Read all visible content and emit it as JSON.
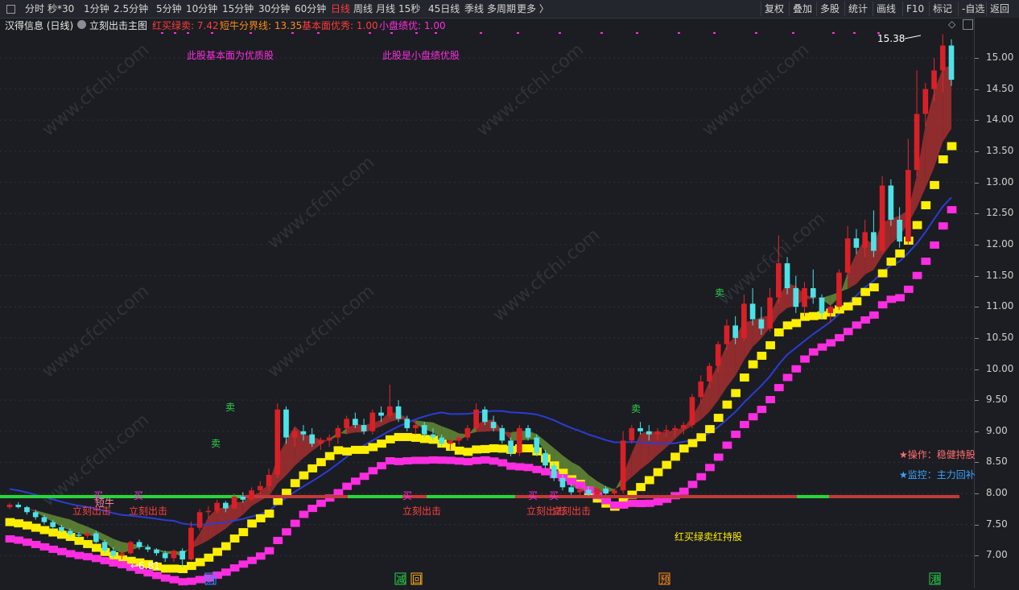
{
  "toolbar": {
    "left_items": [
      "分时",
      "秒*30",
      "1分钟",
      "2.5分钟",
      "5分钟",
      "10分钟",
      "15分钟",
      "30分钟",
      "60分钟",
      "日线",
      "周线",
      "月线",
      "15秒",
      "45日线",
      "季线",
      "多周期",
      "更多 〉"
    ],
    "active_item": "日线",
    "right_items": [
      "复权",
      "叠加",
      "多股",
      "统计",
      "画线",
      "F10",
      "标记",
      "-自选",
      "返回"
    ]
  },
  "info": {
    "stock_name": "汉得信息 (日线)",
    "indicator_name": "立刻出击主图",
    "params": [
      {
        "label": "红买绿卖:",
        "value": "7.42",
        "color": "#ff3b3b"
      },
      {
        "label": "短牛分界线:",
        "value": "13.35",
        "color": "#ff8c1a"
      },
      {
        "label": "基本面优秀:",
        "value": "1.00",
        "color": "#ff3b3b"
      },
      {
        "label": "小盘绩优:",
        "value": "1.00",
        "color": "#ff2de0"
      }
    ]
  },
  "annotations": {
    "fundamentals_good": "此股基本面为优质股",
    "small_cap_good": "此股是小盘绩优股",
    "high_price": "15.38",
    "low_price": "6.81",
    "hold_text": "红买绿卖红持股",
    "operation": "★操作：稳健持股",
    "monitor": "★监控：主力回补",
    "short_bull": "短牛",
    "strike": "立刻出击",
    "sell": "卖",
    "buy": "买",
    "event_cai": "财",
    "event_jian": "减",
    "event_hui": "回",
    "event_yu": "预",
    "event_gang": "港",
    "watermark": "www.cfchi.com"
  },
  "axis": {
    "ticks": [
      "15.00",
      "14.50",
      "14.00",
      "13.50",
      "13.00",
      "12.50",
      "12.00",
      "11.50",
      "11.00",
      "10.50",
      "10.00",
      "9.50",
      "9.00",
      "8.50",
      "8.00",
      "7.50",
      "7.00"
    ]
  },
  "chart_data": {
    "type": "candlestick",
    "title": "立刻出击主图",
    "ylim": [
      6.75,
      15.45
    ],
    "ohlc": [
      [
        7.78,
        7.85,
        7.75,
        7.82
      ],
      [
        7.82,
        7.86,
        7.76,
        7.78
      ],
      [
        7.78,
        7.8,
        7.66,
        7.7
      ],
      [
        7.7,
        7.74,
        7.58,
        7.62
      ],
      [
        7.62,
        7.66,
        7.5,
        7.54
      ],
      [
        7.54,
        7.58,
        7.42,
        7.46
      ],
      [
        7.46,
        7.5,
        7.38,
        7.4
      ],
      [
        7.4,
        7.44,
        7.3,
        7.34
      ],
      [
        7.34,
        7.38,
        7.28,
        7.32
      ],
      [
        7.32,
        7.4,
        7.28,
        7.36
      ],
      [
        7.36,
        7.4,
        7.2,
        7.22
      ],
      [
        7.22,
        7.26,
        7.04,
        7.08
      ],
      [
        7.08,
        7.14,
        6.96,
        7.0
      ],
      [
        7.0,
        7.08,
        6.94,
        7.04
      ],
      [
        7.04,
        7.24,
        7.02,
        7.22
      ],
      [
        7.22,
        7.26,
        7.1,
        7.14
      ],
      [
        7.14,
        7.18,
        7.06,
        7.1
      ],
      [
        7.1,
        7.12,
        7.0,
        7.04
      ],
      [
        7.04,
        7.08,
        6.9,
        6.96
      ],
      [
        6.96,
        7.1,
        6.9,
        7.08
      ],
      [
        7.08,
        7.12,
        6.81,
        6.94
      ],
      [
        6.94,
        7.55,
        6.92,
        7.45
      ],
      [
        7.45,
        7.75,
        7.4,
        7.7
      ],
      [
        7.7,
        7.8,
        7.6,
        7.72
      ],
      [
        7.72,
        7.9,
        7.68,
        7.85
      ],
      [
        7.85,
        7.88,
        7.7,
        7.76
      ],
      [
        7.76,
        8.0,
        7.74,
        7.95
      ],
      [
        7.95,
        8.02,
        7.85,
        7.9
      ],
      [
        7.9,
        8.1,
        7.88,
        8.05
      ],
      [
        8.05,
        8.2,
        7.98,
        8.12
      ],
      [
        8.12,
        8.4,
        8.05,
        8.3
      ],
      [
        8.3,
        9.45,
        8.25,
        9.35
      ],
      [
        9.35,
        9.4,
        8.8,
        8.9
      ],
      [
        8.9,
        9.05,
        8.75,
        9.0
      ],
      [
        9.0,
        9.1,
        8.85,
        8.95
      ],
      [
        8.95,
        9.05,
        8.75,
        8.8
      ],
      [
        8.8,
        8.9,
        8.7,
        8.85
      ],
      [
        8.85,
        8.95,
        8.75,
        8.9
      ],
      [
        8.9,
        9.1,
        8.8,
        9.05
      ],
      [
        9.05,
        9.25,
        8.95,
        9.2
      ],
      [
        9.2,
        9.3,
        9.05,
        9.1
      ],
      [
        9.1,
        9.2,
        8.95,
        9.0
      ],
      [
        9.0,
        9.35,
        8.95,
        9.3
      ],
      [
        9.3,
        9.4,
        9.15,
        9.25
      ],
      [
        9.25,
        9.75,
        9.2,
        9.4
      ],
      [
        9.4,
        9.5,
        9.15,
        9.2
      ],
      [
        9.2,
        9.25,
        9.0,
        9.05
      ],
      [
        9.05,
        9.15,
        8.95,
        9.1
      ],
      [
        9.1,
        9.15,
        8.9,
        8.95
      ],
      [
        8.95,
        9.05,
        8.85,
        8.9
      ],
      [
        8.9,
        8.95,
        8.75,
        8.8
      ],
      [
        8.8,
        8.88,
        8.7,
        8.85
      ],
      [
        8.85,
        8.95,
        8.78,
        8.9
      ],
      [
        8.9,
        9.1,
        8.85,
        9.05
      ],
      [
        9.05,
        9.45,
        9.0,
        9.35
      ],
      [
        9.35,
        9.4,
        9.1,
        9.15
      ],
      [
        9.15,
        9.25,
        9.0,
        9.05
      ],
      [
        9.05,
        9.1,
        8.8,
        8.85
      ],
      [
        8.85,
        8.9,
        8.6,
        8.65
      ],
      [
        8.65,
        9.1,
        8.6,
        9.05
      ],
      [
        9.05,
        9.1,
        8.85,
        8.9
      ],
      [
        8.9,
        8.95,
        8.6,
        8.65
      ],
      [
        8.65,
        8.7,
        8.4,
        8.45
      ],
      [
        8.45,
        8.5,
        8.2,
        8.25
      ],
      [
        8.25,
        8.3,
        8.05,
        8.1
      ],
      [
        8.1,
        8.15,
        7.98,
        8.02
      ],
      [
        8.02,
        8.1,
        7.95,
        8.06
      ],
      [
        8.06,
        8.12,
        7.96,
        7.98
      ],
      [
        7.98,
        8.1,
        7.94,
        8.08
      ],
      [
        8.08,
        8.12,
        7.98,
        8.0
      ],
      [
        8.0,
        8.08,
        7.92,
        8.05
      ],
      [
        8.05,
        9.0,
        8.0,
        8.85
      ],
      [
        8.85,
        9.1,
        8.8,
        9.05
      ],
      [
        9.05,
        9.15,
        8.95,
        9.0
      ],
      [
        9.0,
        9.1,
        8.85,
        8.95
      ],
      [
        8.95,
        9.05,
        8.85,
        9.0
      ],
      [
        9.0,
        9.1,
        8.9,
        9.02
      ],
      [
        9.02,
        9.1,
        8.92,
        9.05
      ],
      [
        9.05,
        9.15,
        8.95,
        9.1
      ],
      [
        9.1,
        9.6,
        9.05,
        9.55
      ],
      [
        9.55,
        9.9,
        9.45,
        9.8
      ],
      [
        9.8,
        10.1,
        9.7,
        10.05
      ],
      [
        10.05,
        10.45,
        9.95,
        10.4
      ],
      [
        10.4,
        10.8,
        10.3,
        10.7
      ],
      [
        10.7,
        10.85,
        10.4,
        10.5
      ],
      [
        10.5,
        11.2,
        10.45,
        11.05
      ],
      [
        11.05,
        11.3,
        10.7,
        10.8
      ],
      [
        10.8,
        11.0,
        10.55,
        10.65
      ],
      [
        10.65,
        11.3,
        10.6,
        11.15
      ],
      [
        11.15,
        12.15,
        11.05,
        11.7
      ],
      [
        11.7,
        11.8,
        11.2,
        11.3
      ],
      [
        11.3,
        11.5,
        10.9,
        11.0
      ],
      [
        11.0,
        11.4,
        10.85,
        11.3
      ],
      [
        11.3,
        11.6,
        11.05,
        11.15
      ],
      [
        11.15,
        11.2,
        10.8,
        10.9
      ],
      [
        10.9,
        11.05,
        10.75,
        11.0
      ],
      [
        11.0,
        11.6,
        10.95,
        11.55
      ],
      [
        11.55,
        12.3,
        11.45,
        12.1
      ],
      [
        12.1,
        12.25,
        11.85,
        11.95
      ],
      [
        11.95,
        12.4,
        11.8,
        12.2
      ],
      [
        12.2,
        12.55,
        11.8,
        11.9
      ],
      [
        11.9,
        13.1,
        11.85,
        12.95
      ],
      [
        12.95,
        13.05,
        12.3,
        12.4
      ],
      [
        12.4,
        12.6,
        11.95,
        12.05
      ],
      [
        12.05,
        13.7,
        12.0,
        13.2
      ],
      [
        13.2,
        14.8,
        13.1,
        14.1
      ],
      [
        14.1,
        14.6,
        13.9,
        14.5
      ],
      [
        14.5,
        15.0,
        14.3,
        14.8
      ],
      [
        14.8,
        15.38,
        14.45,
        15.2
      ],
      [
        15.2,
        15.3,
        14.55,
        14.65
      ]
    ],
    "lines": [
      "红买绿卖 band",
      "短牛分界线",
      "支撑梯线",
      "蓝色均线"
    ]
  }
}
